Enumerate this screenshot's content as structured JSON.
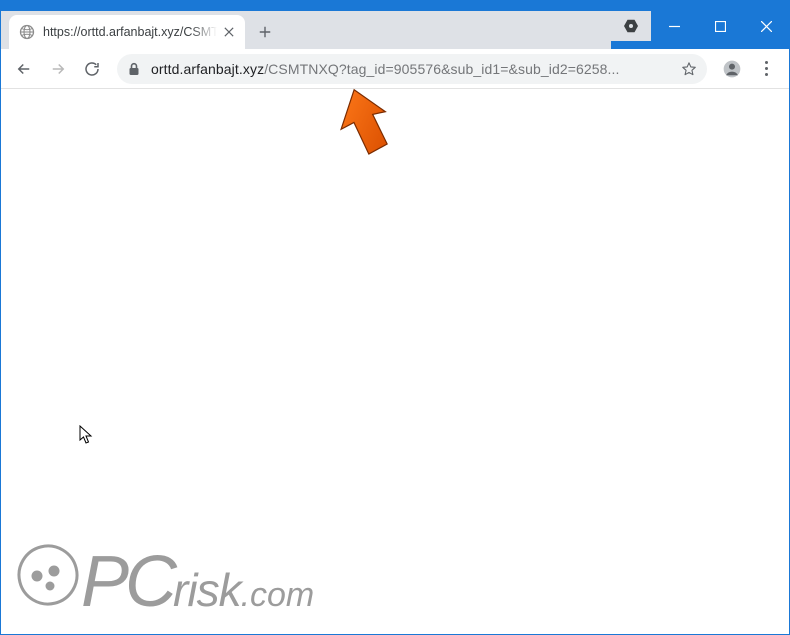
{
  "tab": {
    "title": "https://orttd.arfanbajt.xyz/CSMTNXQ"
  },
  "url": {
    "domain": "orttd.arfanbajt.xyz",
    "path": "/CSMTNXQ?tag_id=905576&sub_id1=&sub_id2=6258..."
  },
  "watermark": {
    "pc": "PC",
    "risk": "risk",
    "com": ".com"
  }
}
